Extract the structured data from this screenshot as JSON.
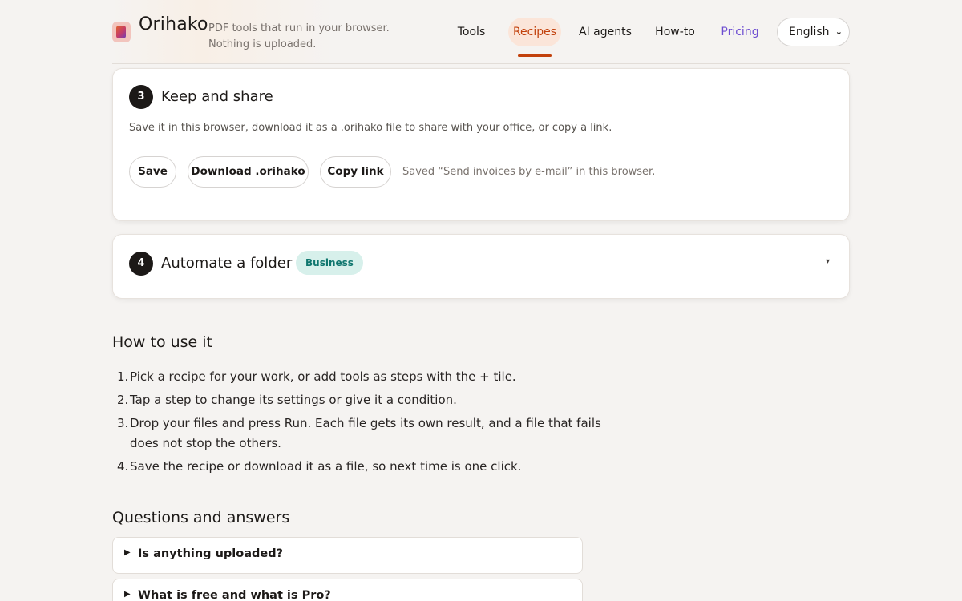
{
  "header": {
    "brand": "Orihako",
    "tagline": "PDF tools that run in your browser. Nothing is uploaded.",
    "nav": [
      {
        "label": "Tools"
      },
      {
        "label": "Recipes",
        "active": true
      },
      {
        "label": "AI agents"
      },
      {
        "label": "How-to"
      },
      {
        "label": "Pricing"
      }
    ],
    "language": "English",
    "logo_icon": "orihako-logo-icon"
  },
  "steps": {
    "keep": {
      "number": "3",
      "title": "Keep and share",
      "description": "Save it in this browser, download it as a .orihako file to share with your office, or copy a link.",
      "buttons": {
        "save": "Save",
        "download": "Download .orihako",
        "copy": "Copy link"
      },
      "status": "Saved “Send invoices by e-mail” in this browser."
    },
    "automate": {
      "number": "4",
      "title": "Automate a folder",
      "badge": "Business",
      "caret": "▾"
    }
  },
  "howto": {
    "title": "How to use it",
    "items": [
      {
        "num": "1.",
        "text": "Pick a recipe for your work, or add tools as steps with the + tile."
      },
      {
        "num": "2.",
        "text": "Tap a step to change its settings or give it a condition."
      },
      {
        "num": "3.",
        "text": "Drop your files and press Run. Each file gets its own result, and a file that fails does not stop the others."
      },
      {
        "num": "4.",
        "text": "Save the recipe or download it as a file, so next time is one click."
      }
    ]
  },
  "faq": {
    "title": "Questions and answers",
    "items": [
      {
        "question": "Is anything uploaded?"
      },
      {
        "question": "What is free and what is Pro?"
      }
    ]
  },
  "colors": {
    "accent": "#c2410c",
    "pricing": "#6d4dd1",
    "badge_bg": "#d7f0eb",
    "badge_text": "#0f766e",
    "background": "#f5f3f1"
  }
}
